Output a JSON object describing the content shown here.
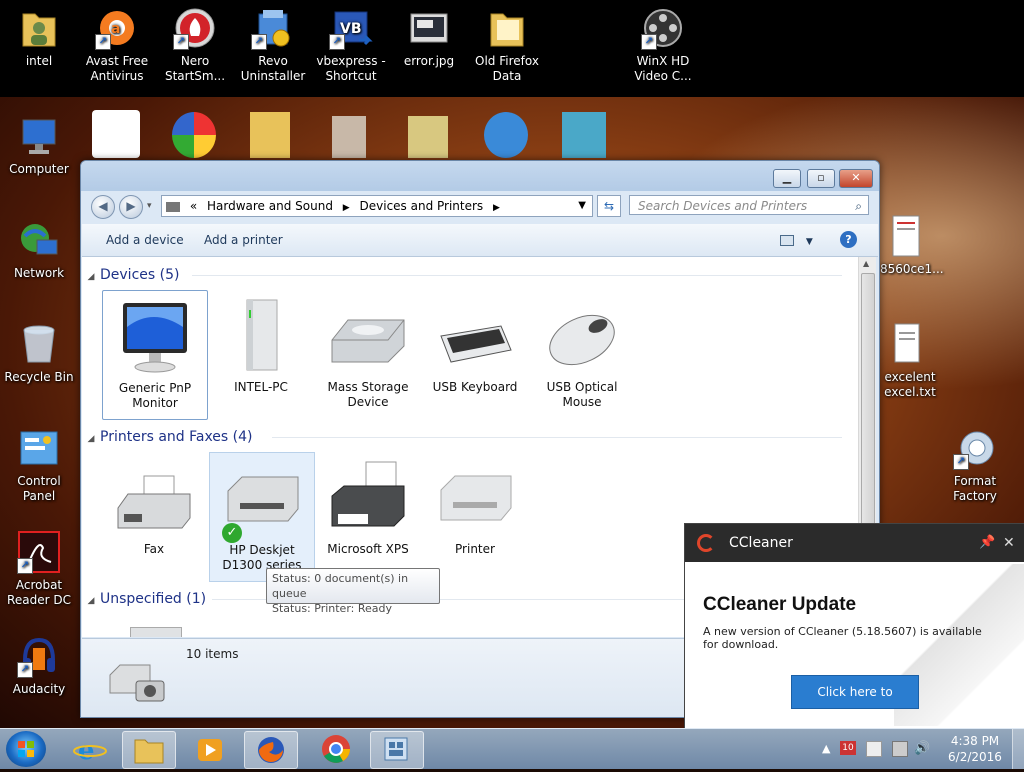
{
  "desktop": {
    "top_icons": [
      {
        "label": "intel",
        "icon": "user-folder-icon"
      },
      {
        "label": "Avast Free Antivirus",
        "icon": "avast-icon"
      },
      {
        "label": "Nero StartSm...",
        "icon": "nero-icon"
      },
      {
        "label": "Revo Uninstaller",
        "icon": "revo-icon"
      },
      {
        "label": "vbexpress - Shortcut",
        "icon": "vb-icon"
      },
      {
        "label": "error.jpg",
        "icon": "image-file-icon"
      },
      {
        "label": "Old Firefox Data",
        "icon": "folder-icon"
      },
      {
        "label": "WinX HD Video C...",
        "icon": "film-reel-icon"
      }
    ],
    "left_icons": [
      {
        "label": "Computer",
        "icon": "computer-icon"
      },
      {
        "label": "Network",
        "icon": "network-icon"
      },
      {
        "label": "Recycle Bin",
        "icon": "recycle-bin-icon"
      },
      {
        "label": "Control Panel",
        "icon": "control-panel-icon"
      },
      {
        "label": "Acrobat Reader DC",
        "icon": "acrobat-icon"
      },
      {
        "label": "Audacity",
        "icon": "audacity-icon"
      }
    ],
    "right_icons": [
      {
        "label": "8560ce1...",
        "icon": "document-icon"
      },
      {
        "label": "excelent excel.txt",
        "icon": "text-file-icon"
      },
      {
        "label": "Format Factory",
        "icon": "format-factory-icon"
      }
    ]
  },
  "explorer": {
    "breadcrumb": [
      "Hardware and Sound",
      "Devices and Printers"
    ],
    "breadcrumb_prefix": "«",
    "search_placeholder": "Search Devices and Printers",
    "toolbar": {
      "add_device": "Add a device",
      "add_printer": "Add a printer"
    },
    "groups": {
      "devices": {
        "header": "Devices (5)",
        "items": [
          {
            "label": "Generic PnP Monitor",
            "icon": "monitor-icon"
          },
          {
            "label": "INTEL-PC",
            "icon": "pc-tower-icon"
          },
          {
            "label": "Mass Storage Device",
            "icon": "hard-drive-icon"
          },
          {
            "label": "USB Keyboard",
            "icon": "keyboard-icon"
          },
          {
            "label": "USB Optical Mouse",
            "icon": "mouse-icon"
          }
        ]
      },
      "printers": {
        "header": "Printers and Faxes (4)",
        "items": [
          {
            "label": "Fax",
            "icon": "fax-icon"
          },
          {
            "label": "HP Deskjet D1300 series",
            "icon": "printer-icon",
            "default": true
          },
          {
            "label": "Microsoft XPS Document Writer",
            "icon": "xps-printer-icon"
          },
          {
            "label": "Printer",
            "icon": "printer-icon"
          }
        ]
      },
      "unspecified": {
        "header": "Unspecified (1)"
      }
    },
    "tooltip": {
      "line1": "Status: 0 document(s) in queue",
      "line2": "Status: Printer:  Ready"
    },
    "details": {
      "count": "10 items"
    }
  },
  "ccleaner": {
    "app": "CCleaner",
    "title": "CCleaner Update",
    "message": "A new version of CCleaner (5.18.5607) is available for download.",
    "button": "Click here to download",
    "accent": "#2a7dd0"
  },
  "taskbar": {
    "time": "4:38 PM",
    "date": "6/2/2016",
    "apps": [
      "internet-explorer-icon",
      "file-explorer-icon",
      "media-player-icon",
      "firefox-icon",
      "chrome-icon",
      "devices-printers-icon"
    ]
  }
}
